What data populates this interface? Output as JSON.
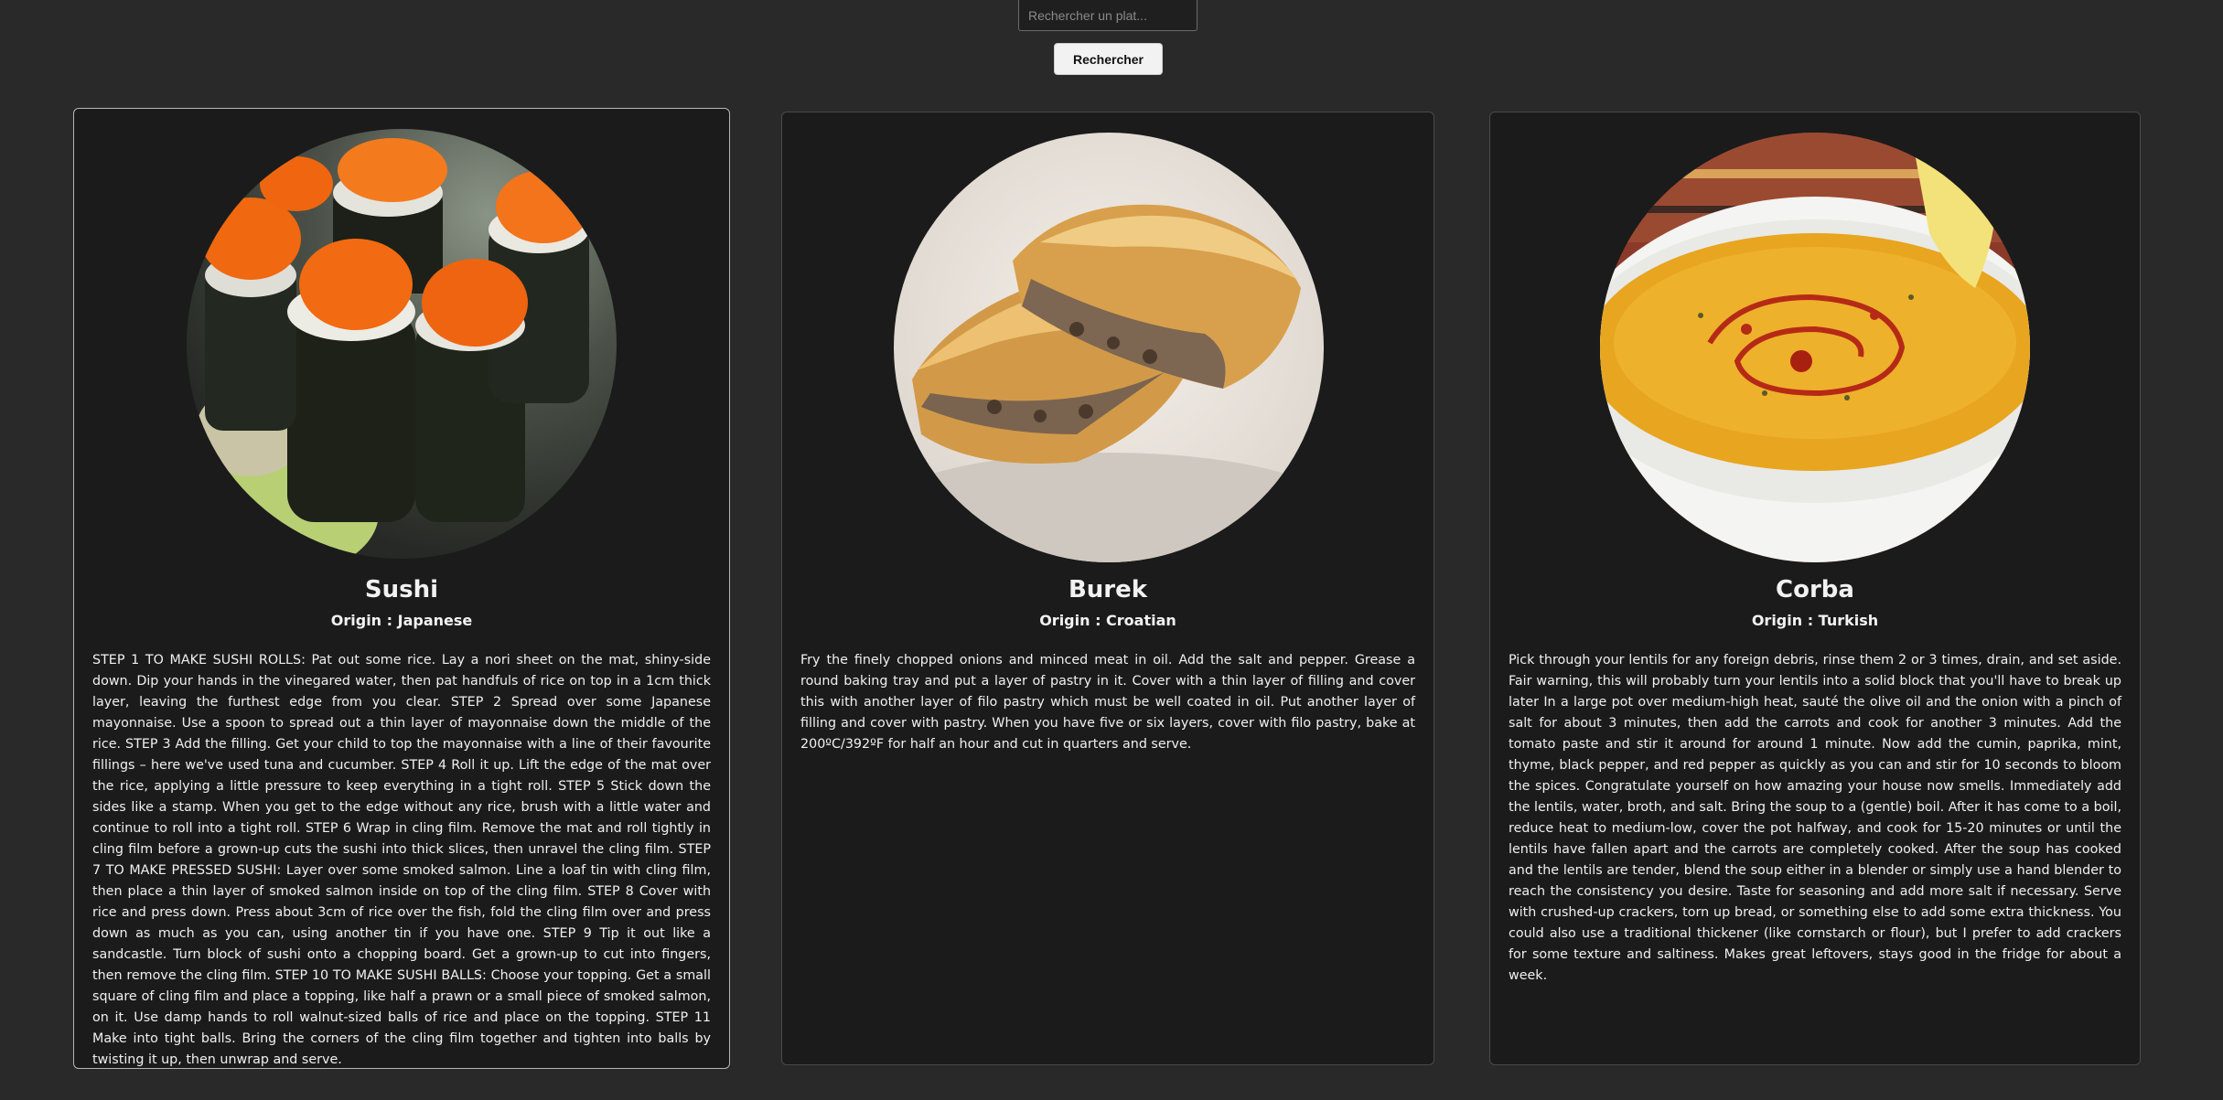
{
  "search": {
    "placeholder": "Rechercher un plat...",
    "value": "",
    "button_label": "Rechercher"
  },
  "meals": [
    {
      "name": "Sushi",
      "origin": "Origin : Japanese",
      "image_icon": "sushi-image",
      "instructions": "STEP 1 TO MAKE SUSHI ROLLS: Pat out some rice. Lay a nori sheet on the mat, shiny-side down. Dip your hands in the vinegared water, then pat handfuls of rice on top in a 1cm thick layer, leaving the furthest edge from you clear. STEP 2 Spread over some Japanese mayonnaise. Use a spoon to spread out a thin layer of mayonnaise down the middle of the rice. STEP 3 Add the filling. Get your child to top the mayonnaise with a line of their favourite fillings – here we've used tuna and cucumber. STEP 4 Roll it up. Lift the edge of the mat over the rice, applying a little pressure to keep everything in a tight roll. STEP 5 Stick down the sides like a stamp. When you get to the edge without any rice, brush with a little water and continue to roll into a tight roll. STEP 6 Wrap in cling film. Remove the mat and roll tightly in cling film before a grown-up cuts the sushi into thick slices, then unravel the cling film. STEP 7 TO MAKE PRESSED SUSHI: Layer over some smoked salmon. Line a loaf tin with cling film, then place a thin layer of smoked salmon inside on top of the cling film. STEP 8 Cover with rice and press down. Press about 3cm of rice over the fish, fold the cling film over and press down as much as you can, using another tin if you have one. STEP 9 Tip it out like a sandcastle. Turn block of sushi onto a chopping board. Get a grown-up to cut into fingers, then remove the cling film. STEP 10 TO MAKE SUSHI BALLS: Choose your topping. Get a small square of cling film and place a topping, like half a prawn or a small piece of smoked salmon, on it. Use damp hands to roll walnut-sized balls of rice and place on the topping. STEP 11 Make into tight balls. Bring the corners of the cling film together and tighten into balls by twisting it up, then unwrap and serve."
    },
    {
      "name": "Burek",
      "origin": "Origin : Croatian",
      "image_icon": "burek-image",
      "instructions": "Fry the finely chopped onions and minced meat in oil. Add the salt and pepper. Grease a round baking tray and put a layer of pastry in it. Cover with a thin layer of filling and cover this with another layer of filo pastry which must be well coated in oil. Put another layer of filling and cover with pastry. When you have five or six layers, cover with filo pastry, bake at 200ºC/392ºF for half an hour and cut in quarters and serve."
    },
    {
      "name": "Corba",
      "origin": "Origin : Turkish",
      "image_icon": "corba-image",
      "instructions": "Pick through your lentils for any foreign debris, rinse them 2 or 3 times, drain, and set aside. Fair warning, this will probably turn your lentils into a solid block that you'll have to break up later In a large pot over medium-high heat, sauté the olive oil and the onion with a pinch of salt for about 3 minutes, then add the carrots and cook for another 3 minutes. Add the tomato paste and stir it around for around 1 minute. Now add the cumin, paprika, mint, thyme, black pepper, and red pepper as quickly as you can and stir for 10 seconds to bloom the spices. Congratulate yourself on how amazing your house now smells. Immediately add the lentils, water, broth, and salt. Bring the soup to a (gentle) boil. After it has come to a boil, reduce heat to medium-low, cover the pot halfway, and cook for 15-20 minutes or until the lentils have fallen apart and the carrots are completely cooked. After the soup has cooked and the lentils are tender, blend the soup either in a blender or simply use a hand blender to reach the consistency you desire. Taste for seasoning and add more salt if necessary. Serve with crushed-up crackers, torn up bread, or something else to add some extra thickness. You could also use a traditional thickener (like cornstarch or flour), but I prefer to add crackers for some texture and saltiness. Makes great leftovers, stays good in the fridge for about a week."
    }
  ],
  "colors": {
    "background": "#292929",
    "card_background": "#1b1b1b",
    "card_border": "#4a4a4a",
    "text": "#f0f0f0"
  }
}
